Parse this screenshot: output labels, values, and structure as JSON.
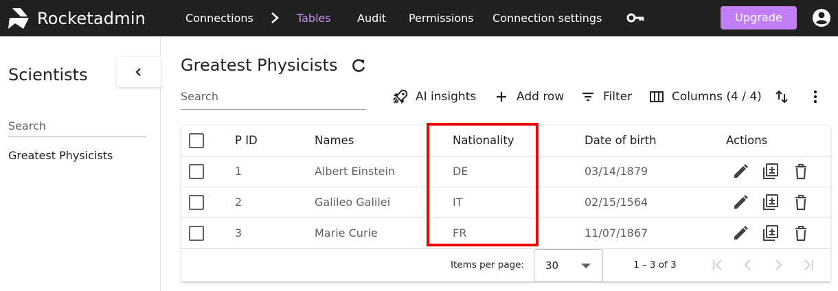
{
  "app": {
    "brand": "Rocketadmin"
  },
  "nav": {
    "connections": "Connections",
    "tables": "Tables",
    "audit": "Audit",
    "permissions": "Permissions",
    "connection_settings": "Connection settings",
    "upgrade": "Upgrade"
  },
  "sidebar": {
    "title": "Scientists",
    "search_placeholder": "Search",
    "items": [
      {
        "label": "Greatest Physicists"
      }
    ]
  },
  "main": {
    "title": "Greatest Physicists",
    "search_placeholder": "Search",
    "toolbar": {
      "ai_insights": "AI insights",
      "add_row": "Add row",
      "filter": "Filter",
      "columns": "Columns (4 / 4)"
    }
  },
  "table": {
    "headers": {
      "id": "P ID",
      "names": "Names",
      "nationality": "Nationality",
      "dob": "Date of birth",
      "actions": "Actions"
    },
    "rows": [
      {
        "id": "1",
        "name": "Albert Einstein",
        "nationality": "DE",
        "dob": "03/14/1879"
      },
      {
        "id": "2",
        "name": "Galileo Galilei",
        "nationality": "IT",
        "dob": "02/15/1564"
      },
      {
        "id": "3",
        "name": "Marie Curie",
        "nationality": "FR",
        "dob": "11/07/1867"
      }
    ]
  },
  "pagination": {
    "items_per_page_label": "Items per page:",
    "page_size": "30",
    "range": "1 – 3 of 3"
  },
  "colors": {
    "topbar": "#212121",
    "accent": "#c17ef5",
    "active_nav": "#c895f5",
    "highlight": "#ee0000"
  }
}
